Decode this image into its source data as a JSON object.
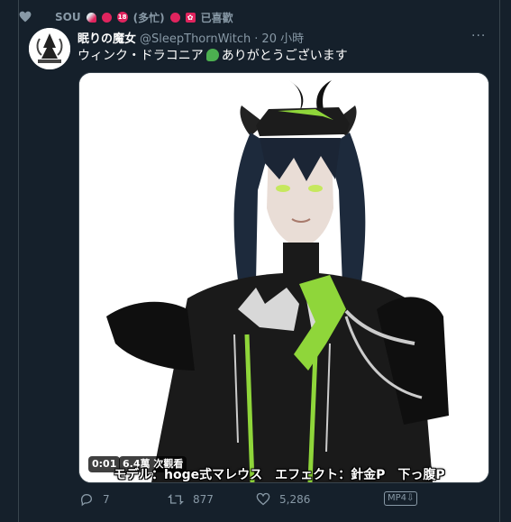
{
  "social_context": {
    "icon": "heart-icon",
    "user_name": "SOU",
    "name_emojis": [
      "rocket",
      "crab",
      "18",
      "apple",
      "hk-flag"
    ],
    "user_status": "(多忙)",
    "action_label": "已喜歡"
  },
  "tweet": {
    "author_name": "眠りの魔女",
    "author_handle": "@SleepThornWitch",
    "separator": "·",
    "timestamp": "20 小時",
    "more_label": "···",
    "text_before": "ウィンク・ドラコニア",
    "text_after": "ありがとうございます",
    "text_emoji": "dragon"
  },
  "media": {
    "video_time": "0:01",
    "view_count": "6.4萬 次觀看",
    "subtitle": "モデル：hoge式マレウス　エフェクト：針金P　下っ腹P"
  },
  "actions": {
    "reply_count": "7",
    "retweet_count": "877",
    "like_count": "5,286",
    "format_badge": "MP4"
  },
  "colors": {
    "background": "#15202b",
    "muted": "#8899a6",
    "border": "#38444d",
    "accent_green": "#8fd63a"
  }
}
